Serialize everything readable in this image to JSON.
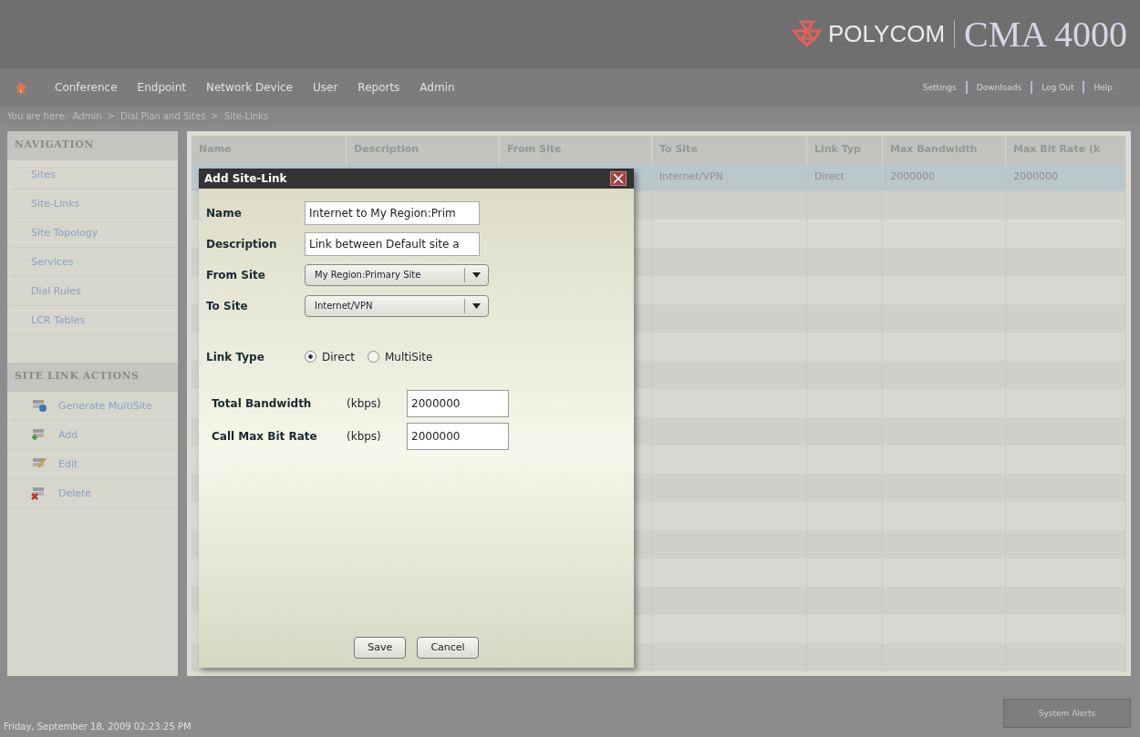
{
  "brand": {
    "company": "POLYCOM",
    "product": "CMA 4000"
  },
  "menu": [
    {
      "label": "Conference"
    },
    {
      "label": "Endpoint"
    },
    {
      "label": "Network Device"
    },
    {
      "label": "User"
    },
    {
      "label": "Reports"
    },
    {
      "label": "Admin"
    }
  ],
  "top_links": [
    "Settings",
    "Downloads",
    "Log Out",
    "Help"
  ],
  "breadcrumb": [
    "You are here:",
    "Admin",
    ">",
    "Dial Plan and Sites",
    ">",
    "Site-Links"
  ],
  "navigation": {
    "title": "NAVIGATION",
    "items": [
      {
        "label": "Sites"
      },
      {
        "label": "Site-Links"
      },
      {
        "label": "Site Topology"
      },
      {
        "label": "Services"
      },
      {
        "label": "Dial Rules"
      },
      {
        "label": "LCR Tables"
      }
    ]
  },
  "actions": {
    "title": "SITE LINK ACTIONS",
    "items": [
      {
        "label": "Generate MultiSite",
        "kind": "generate"
      },
      {
        "label": "Add",
        "kind": "add"
      },
      {
        "label": "Edit",
        "kind": "edit"
      },
      {
        "label": "Delete",
        "kind": "delete"
      }
    ]
  },
  "table": {
    "columns": [
      "Name",
      "Description",
      "From Site",
      "To Site",
      "Link Typ",
      "Max Bandwidth",
      "Max Bit Rate (k"
    ],
    "rows": [
      {
        "selected": true,
        "cells": [
          "",
          "",
          "",
          "Internet/VPN",
          "Direct",
          "2000000",
          "2000000"
        ]
      }
    ]
  },
  "dialog": {
    "title": "Add Site-Link",
    "name_label": "Name",
    "name_value": "Internet to My Region:Prim",
    "description_label": "Description",
    "description_value": "Link between Default site a",
    "from_label": "From Site",
    "from_value": "My Region:Primary Site",
    "to_label": "To Site",
    "to_value": "Internet/VPN",
    "link_type_label": "Link Type",
    "link_types": [
      {
        "label": "Direct",
        "selected": true
      },
      {
        "label": "MultiSite",
        "selected": false
      }
    ],
    "bandwidth_label": "Total Bandwidth",
    "bandwidth_unit": "(kbps)",
    "bandwidth_value": "2000000",
    "bitrate_label": "Call Max Bit Rate",
    "bitrate_unit": "(kbps)",
    "bitrate_value": "2000000",
    "save": "Save",
    "cancel": "Cancel"
  },
  "status_bar": {
    "datetime": "Friday, September 18, 2009 02:23:25 PM",
    "alerts": "System Alerts"
  }
}
